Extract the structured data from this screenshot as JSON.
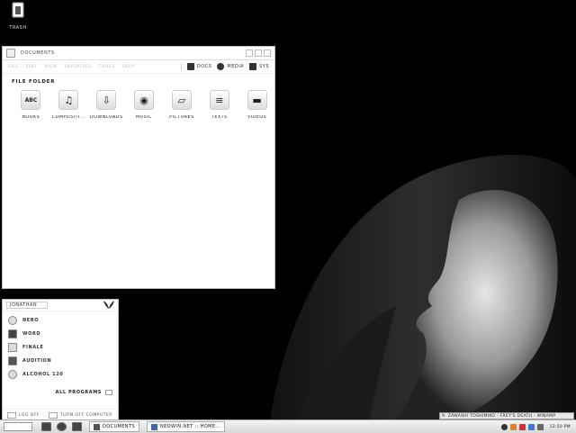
{
  "desktop": {
    "trash_label": "TRASH"
  },
  "window": {
    "title": "DOCUMENTS",
    "menu": [
      "FILE",
      "EDIT",
      "VIEW",
      "FAVORITES",
      "TOOLS",
      "HELP"
    ],
    "locations": [
      {
        "label": "DOCS",
        "icon": "document-icon"
      },
      {
        "label": "MEDIA",
        "icon": "media-icon"
      },
      {
        "label": "SYS",
        "icon": "system-icon"
      }
    ],
    "folder_title": "FILE FOLDER",
    "folders": [
      {
        "label": "BOOKS",
        "icon": "books-icon",
        "glyph": "ABC"
      },
      {
        "label": "COMPOSITI...",
        "icon": "music-note-icon",
        "glyph": "♫"
      },
      {
        "label": "DOWNLOADS",
        "icon": "downloads-icon",
        "glyph": "⇩"
      },
      {
        "label": "MUSIC",
        "icon": "speaker-icon",
        "glyph": "◉"
      },
      {
        "label": "PICTURES",
        "icon": "pictures-icon",
        "glyph": "▱"
      },
      {
        "label": "TEXTS",
        "icon": "texts-icon",
        "glyph": "≡"
      },
      {
        "label": "VIDEOS",
        "icon": "clapper-icon",
        "glyph": "▬"
      }
    ]
  },
  "start_menu": {
    "user": "JONATHAN",
    "apps": [
      "NERO",
      "WORD",
      "FINALE",
      "AUDITION",
      "ALCOHOL 120"
    ],
    "all_programs": "ALL PROGRAMS",
    "log_off": "LOG OFF",
    "turn_off": "TURN OFF COMPUTER"
  },
  "now_playing": "9. ZAWASHI TOSHIMIKO - FREY'S DEATH - WINAMP",
  "taskbar": {
    "tasks": [
      "DOCUMENTS",
      "NEOWIN.NET :: HOME..."
    ],
    "clock": "12:50 PM"
  }
}
